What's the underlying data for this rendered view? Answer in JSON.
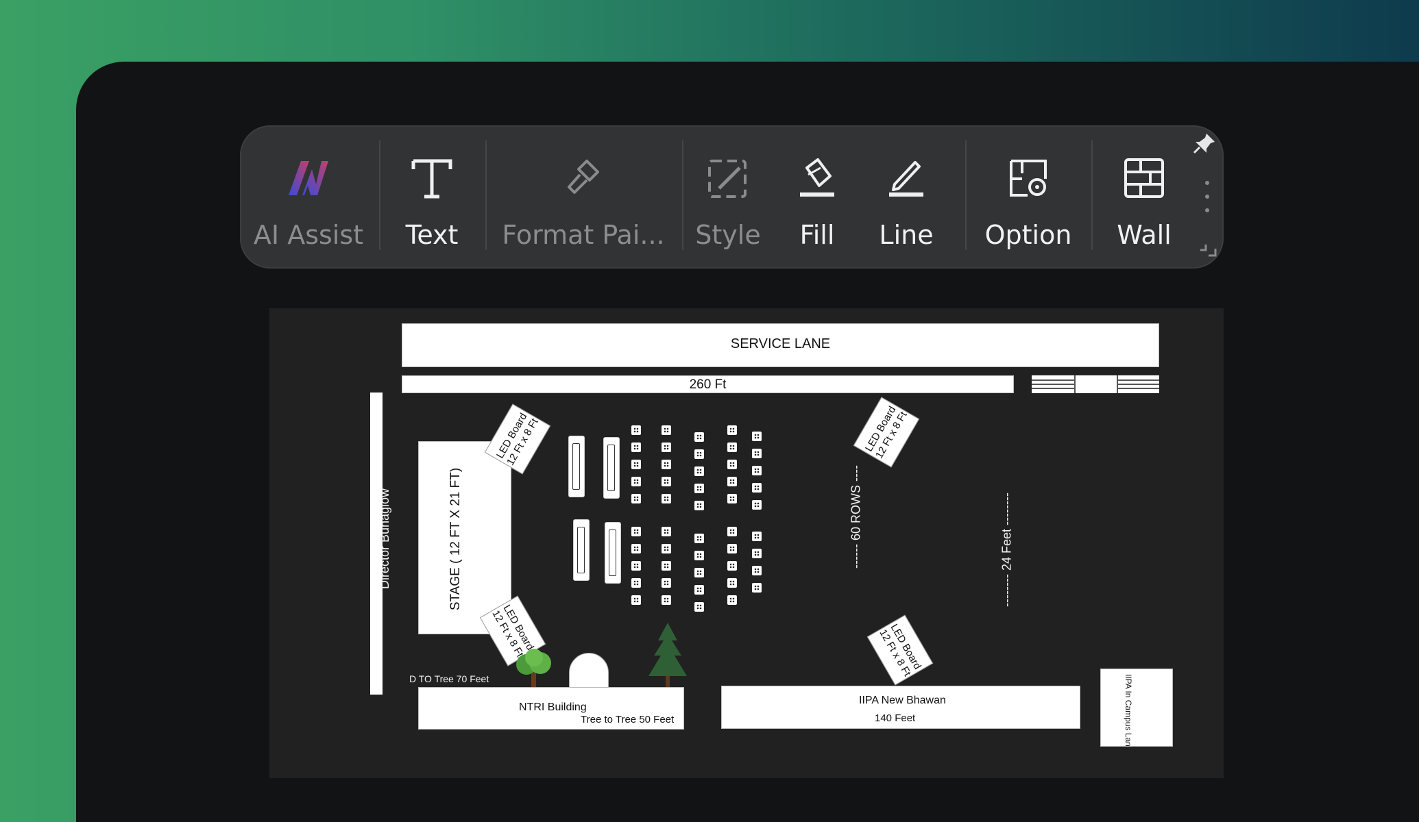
{
  "toolbar": {
    "items": [
      {
        "label": "AI Assist",
        "icon": "ai-assist-logo-icon",
        "enabled": false
      },
      {
        "label": "Text",
        "icon": "text-icon",
        "enabled": true
      },
      {
        "label": "Format Pai...",
        "icon": "format-painter-icon",
        "enabled": false
      },
      {
        "label": "Style",
        "icon": "style-icon",
        "enabled": false
      },
      {
        "label": "Fill",
        "icon": "fill-bucket-icon",
        "enabled": true
      },
      {
        "label": "Line",
        "icon": "line-pen-icon",
        "enabled": true
      },
      {
        "label": "Option",
        "icon": "option-icon",
        "enabled": true
      },
      {
        "label": "Wall",
        "icon": "wall-icon",
        "enabled": true
      }
    ],
    "pin_icon": "pin-icon",
    "more_icon": "more-vertical-icon"
  },
  "floorplan": {
    "service_lane": "SERVICE LANE",
    "width_label": "260 Ft",
    "director": "Director Bunaglow",
    "stage": "STAGE ( 12 FT X 21 FT)",
    "led_board_label": "LED Board",
    "led_board_size": "12 Ft x 8 Ft",
    "rows_label": "------ 60 ROWS ----",
    "feet_label": "-------- 24 Feet --------",
    "d_to_tree": "D TO Tree 70 Feet",
    "ntri": "NTRI Building",
    "tree_to_tree": "Tree to Tree 50 Feet",
    "iipa": "IIPA New Bhawan",
    "iipa_length": "140 Feet",
    "campus": "IIPA In Campus Lan"
  },
  "colors": {
    "background_gradient_start": "#3aa064",
    "background_gradient_end": "#0e3b4d",
    "window": "#121314",
    "toolbar": "#323334",
    "canvas": "#212121"
  }
}
